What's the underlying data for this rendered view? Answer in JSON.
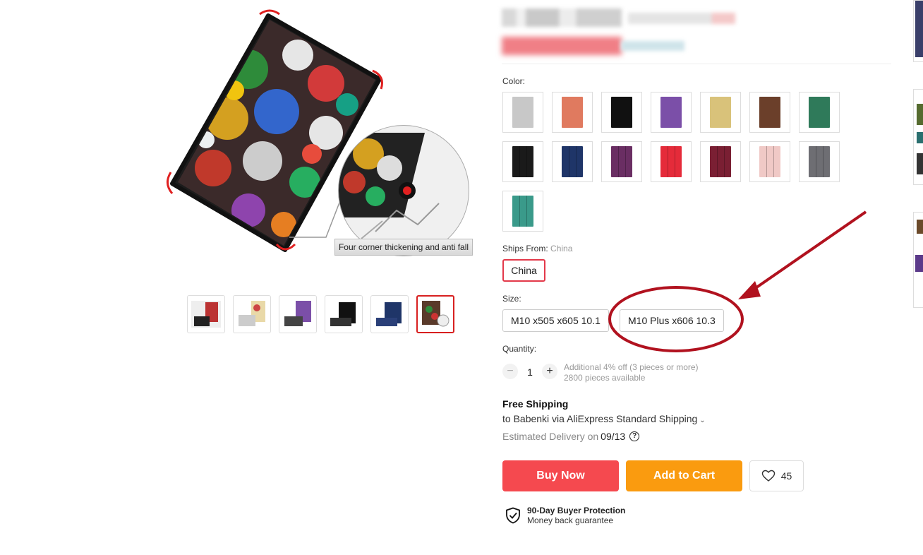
{
  "gallery": {
    "zoom_caption": "Four corner thickening and anti fall",
    "thumbnails": [
      "thumb-1",
      "thumb-2",
      "thumb-3",
      "thumb-4",
      "thumb-5",
      "thumb-6"
    ]
  },
  "product": {
    "color_label": "Color:",
    "swatch_colors": [
      "#c8c8c8",
      "#e07a5f",
      "#111111",
      "#7b4fa8",
      "#d9c27a",
      "#6b3f2a",
      "#2f7a5a",
      "#1a1a1a",
      "#1f3568",
      "#6a2e63",
      "#e52b3a",
      "#7a1f33",
      "#f0c9c6",
      "#6e6e73",
      "#3a9a8a"
    ],
    "ships_label": "Ships From:",
    "ships_selected": "China",
    "ships_option": "China",
    "size_label": "Size:",
    "size_options": [
      "M10 x505 x605 10.1",
      "M10 Plus x606 10.3"
    ],
    "quantity_label": "Quantity:",
    "quantity_value": "1",
    "quantity_minus": "−",
    "quantity_plus": "+",
    "discount_text": "Additional 4% off (3 pieces or more)",
    "available_text": "2800 pieces available"
  },
  "shipping": {
    "title": "Free Shipping",
    "line": "to Babenki via AliExpress Standard Shipping",
    "delivery_label": "Estimated Delivery on",
    "delivery_date": "09/13",
    "help_icon": "?"
  },
  "actions": {
    "buy_now": "Buy Now",
    "add_to_cart": "Add to Cart",
    "wishlist_count": "45"
  },
  "protection": {
    "title": "90-Day Buyer Protection",
    "subtitle": "Money back guarantee"
  },
  "colors": {
    "accent_red": "#f5494f",
    "accent_orange": "#fa9b0f",
    "annotation": "#b1121f"
  }
}
